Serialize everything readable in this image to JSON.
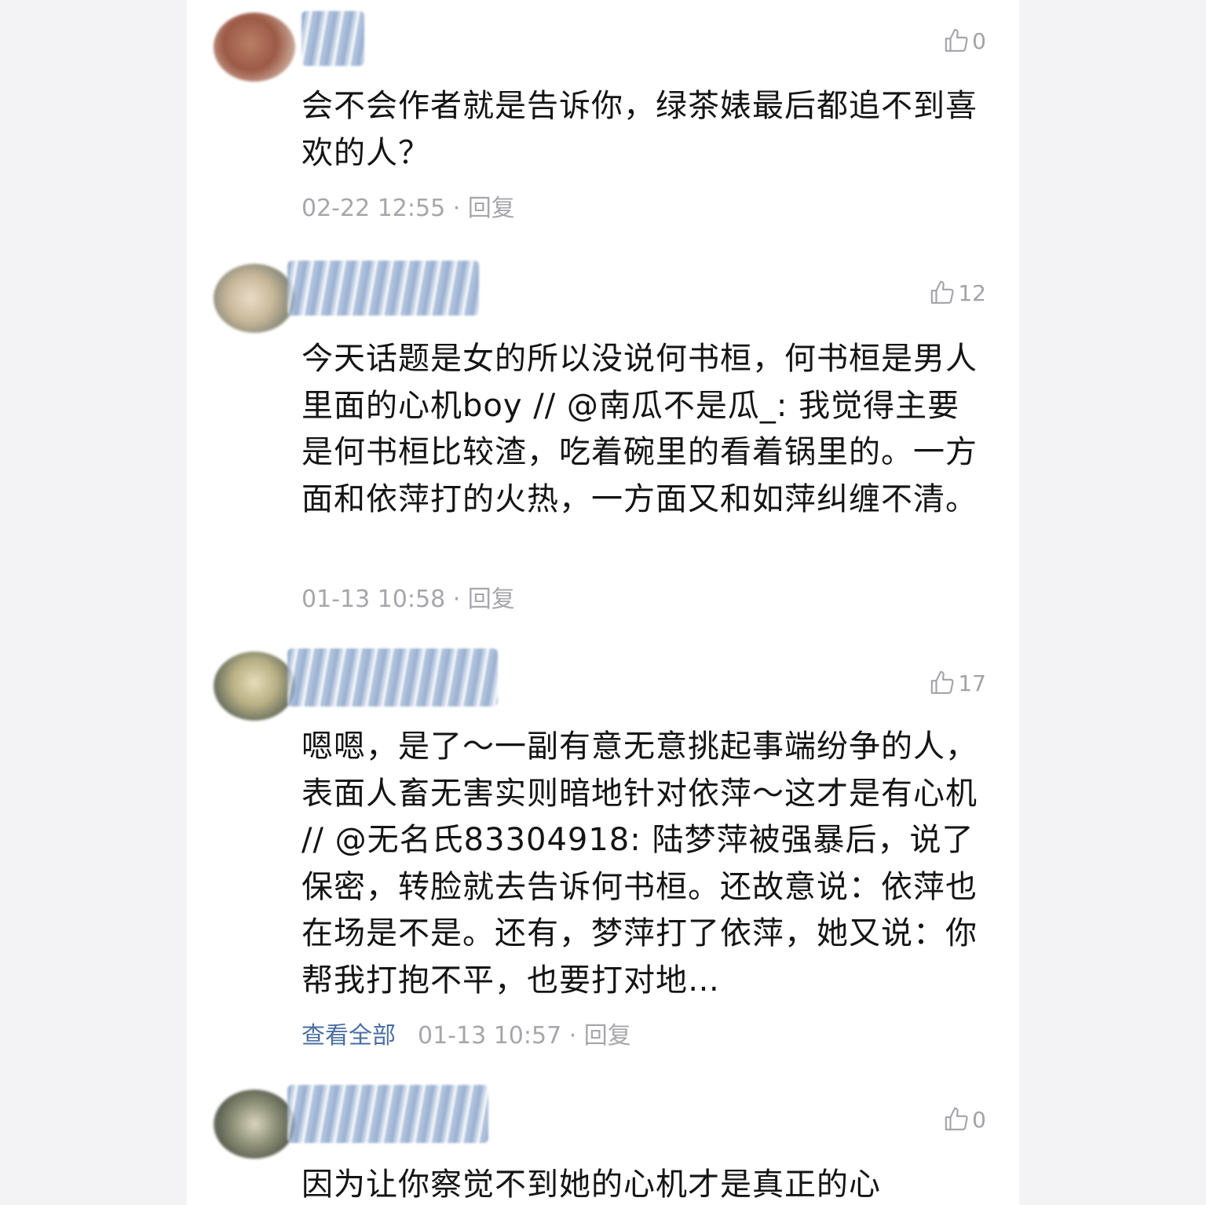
{
  "comments": [
    {
      "likes": "0",
      "text": "会不会作者就是告诉你，绿茶婊最后都追不到喜欢的人？",
      "time": "02-22 12:55",
      "sep": " · ",
      "reply": "回复"
    },
    {
      "likes": "12",
      "text": "今天话题是女的所以没说何书桓，何书桓是男人里面的心机boy // @南瓜不是瓜_: 我觉得主要是何书桓比较渣，吃着碗里的看着锅里的。一方面和依萍打的火热，一方面又和如萍纠缠不清。",
      "time": "01-13 10:58",
      "sep": " · ",
      "reply": "回复"
    },
    {
      "likes": "17",
      "text": "嗯嗯，是了～一副有意无意挑起事端纷争的人，表面人畜无害实则暗地针对依萍～这才是有心机 // @无名氏83304918: 陆梦萍被强暴后，说了保密，转脸就去告诉何书桓。还故意说：依萍也在场是不是。还有，梦萍打了依萍，她又说：你帮我打抱不平，也要打对地…",
      "view_all": "查看全部",
      "time": "01-13 10:57",
      "sep": " · ",
      "reply": "回复"
    },
    {
      "likes": "0",
      "text": "因为让你察觉不到她的心机才是真正的心"
    }
  ]
}
